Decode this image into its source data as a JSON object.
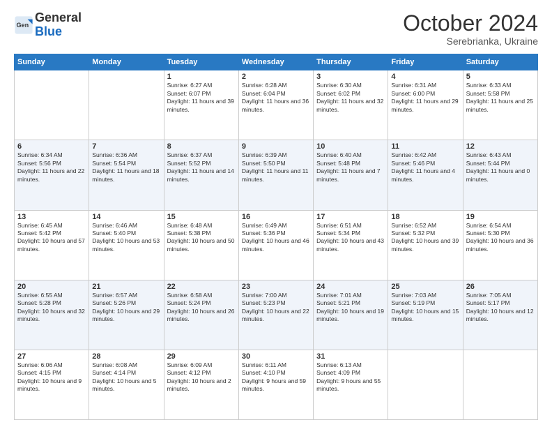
{
  "header": {
    "logo_general": "General",
    "logo_blue": "Blue",
    "month": "October 2024",
    "location": "Serebrianka, Ukraine"
  },
  "weekdays": [
    "Sunday",
    "Monday",
    "Tuesday",
    "Wednesday",
    "Thursday",
    "Friday",
    "Saturday"
  ],
  "weeks": [
    [
      {
        "day": "",
        "info": ""
      },
      {
        "day": "",
        "info": ""
      },
      {
        "day": "1",
        "info": "Sunrise: 6:27 AM\nSunset: 6:07 PM\nDaylight: 11 hours and 39 minutes."
      },
      {
        "day": "2",
        "info": "Sunrise: 6:28 AM\nSunset: 6:04 PM\nDaylight: 11 hours and 36 minutes."
      },
      {
        "day": "3",
        "info": "Sunrise: 6:30 AM\nSunset: 6:02 PM\nDaylight: 11 hours and 32 minutes."
      },
      {
        "day": "4",
        "info": "Sunrise: 6:31 AM\nSunset: 6:00 PM\nDaylight: 11 hours and 29 minutes."
      },
      {
        "day": "5",
        "info": "Sunrise: 6:33 AM\nSunset: 5:58 PM\nDaylight: 11 hours and 25 minutes."
      }
    ],
    [
      {
        "day": "6",
        "info": "Sunrise: 6:34 AM\nSunset: 5:56 PM\nDaylight: 11 hours and 22 minutes."
      },
      {
        "day": "7",
        "info": "Sunrise: 6:36 AM\nSunset: 5:54 PM\nDaylight: 11 hours and 18 minutes."
      },
      {
        "day": "8",
        "info": "Sunrise: 6:37 AM\nSunset: 5:52 PM\nDaylight: 11 hours and 14 minutes."
      },
      {
        "day": "9",
        "info": "Sunrise: 6:39 AM\nSunset: 5:50 PM\nDaylight: 11 hours and 11 minutes."
      },
      {
        "day": "10",
        "info": "Sunrise: 6:40 AM\nSunset: 5:48 PM\nDaylight: 11 hours and 7 minutes."
      },
      {
        "day": "11",
        "info": "Sunrise: 6:42 AM\nSunset: 5:46 PM\nDaylight: 11 hours and 4 minutes."
      },
      {
        "day": "12",
        "info": "Sunrise: 6:43 AM\nSunset: 5:44 PM\nDaylight: 11 hours and 0 minutes."
      }
    ],
    [
      {
        "day": "13",
        "info": "Sunrise: 6:45 AM\nSunset: 5:42 PM\nDaylight: 10 hours and 57 minutes."
      },
      {
        "day": "14",
        "info": "Sunrise: 6:46 AM\nSunset: 5:40 PM\nDaylight: 10 hours and 53 minutes."
      },
      {
        "day": "15",
        "info": "Sunrise: 6:48 AM\nSunset: 5:38 PM\nDaylight: 10 hours and 50 minutes."
      },
      {
        "day": "16",
        "info": "Sunrise: 6:49 AM\nSunset: 5:36 PM\nDaylight: 10 hours and 46 minutes."
      },
      {
        "day": "17",
        "info": "Sunrise: 6:51 AM\nSunset: 5:34 PM\nDaylight: 10 hours and 43 minutes."
      },
      {
        "day": "18",
        "info": "Sunrise: 6:52 AM\nSunset: 5:32 PM\nDaylight: 10 hours and 39 minutes."
      },
      {
        "day": "19",
        "info": "Sunrise: 6:54 AM\nSunset: 5:30 PM\nDaylight: 10 hours and 36 minutes."
      }
    ],
    [
      {
        "day": "20",
        "info": "Sunrise: 6:55 AM\nSunset: 5:28 PM\nDaylight: 10 hours and 32 minutes."
      },
      {
        "day": "21",
        "info": "Sunrise: 6:57 AM\nSunset: 5:26 PM\nDaylight: 10 hours and 29 minutes."
      },
      {
        "day": "22",
        "info": "Sunrise: 6:58 AM\nSunset: 5:24 PM\nDaylight: 10 hours and 26 minutes."
      },
      {
        "day": "23",
        "info": "Sunrise: 7:00 AM\nSunset: 5:23 PM\nDaylight: 10 hours and 22 minutes."
      },
      {
        "day": "24",
        "info": "Sunrise: 7:01 AM\nSunset: 5:21 PM\nDaylight: 10 hours and 19 minutes."
      },
      {
        "day": "25",
        "info": "Sunrise: 7:03 AM\nSunset: 5:19 PM\nDaylight: 10 hours and 15 minutes."
      },
      {
        "day": "26",
        "info": "Sunrise: 7:05 AM\nSunset: 5:17 PM\nDaylight: 10 hours and 12 minutes."
      }
    ],
    [
      {
        "day": "27",
        "info": "Sunrise: 6:06 AM\nSunset: 4:15 PM\nDaylight: 10 hours and 9 minutes."
      },
      {
        "day": "28",
        "info": "Sunrise: 6:08 AM\nSunset: 4:14 PM\nDaylight: 10 hours and 5 minutes."
      },
      {
        "day": "29",
        "info": "Sunrise: 6:09 AM\nSunset: 4:12 PM\nDaylight: 10 hours and 2 minutes."
      },
      {
        "day": "30",
        "info": "Sunrise: 6:11 AM\nSunset: 4:10 PM\nDaylight: 9 hours and 59 minutes."
      },
      {
        "day": "31",
        "info": "Sunrise: 6:13 AM\nSunset: 4:09 PM\nDaylight: 9 hours and 55 minutes."
      },
      {
        "day": "",
        "info": ""
      },
      {
        "day": "",
        "info": ""
      }
    ]
  ]
}
